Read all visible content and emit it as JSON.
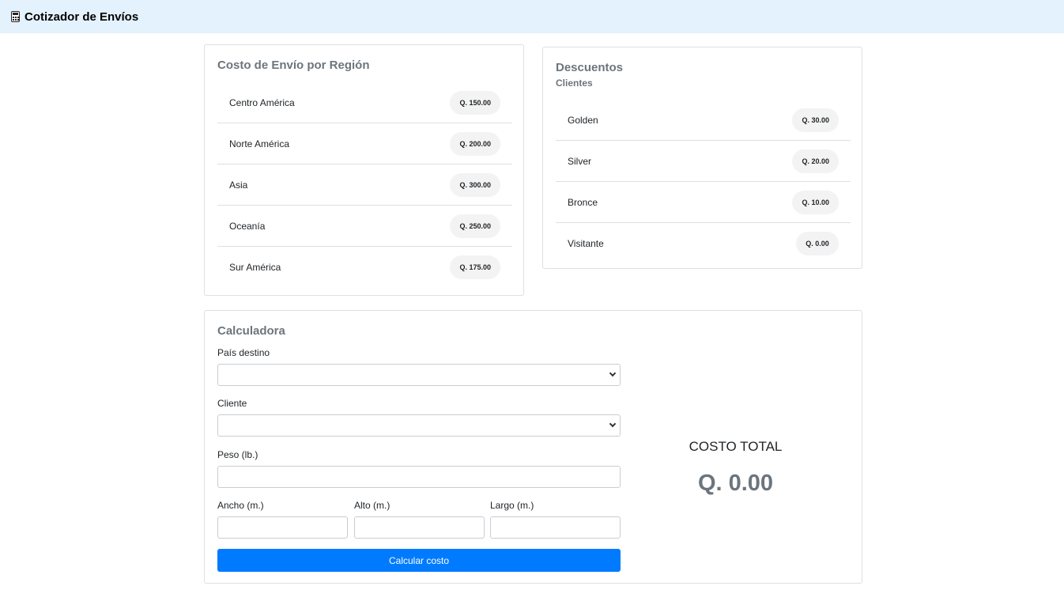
{
  "app": {
    "title": "Cotizador de Envíos",
    "icon": "calculator-icon"
  },
  "regions": {
    "title": "Costo de Envío por Región",
    "items": [
      {
        "label": "Centro América",
        "price": "Q. 150.00"
      },
      {
        "label": "Norte América",
        "price": "Q. 200.00"
      },
      {
        "label": "Asia",
        "price": "Q. 300.00"
      },
      {
        "label": "Oceanía",
        "price": "Q. 250.00"
      },
      {
        "label": "Sur América",
        "price": "Q. 175.00"
      }
    ]
  },
  "discounts": {
    "title": "Descuentos",
    "subtitle": "Clientes",
    "items": [
      {
        "label": "Golden",
        "price": "Q. 30.00"
      },
      {
        "label": "Silver",
        "price": "Q. 20.00"
      },
      {
        "label": "Bronce",
        "price": "Q. 10.00"
      },
      {
        "label": "Visitante",
        "price": "Q. 0.00"
      }
    ]
  },
  "calculator": {
    "title": "Calculadora",
    "country_label": "País destino",
    "country_value": "",
    "client_label": "Cliente",
    "client_value": "",
    "weight_label": "Peso (lb.)",
    "weight_value": "",
    "width_label": "Ancho (m.)",
    "width_value": "",
    "height_label": "Alto (m.)",
    "height_value": "",
    "length_label": "Largo (m.)",
    "length_value": "",
    "button_label": "Calcular costo",
    "total_label": "COSTO TOTAL",
    "total_value": "Q. 0.00"
  },
  "colors": {
    "navbar_bg": "#e3f2fd",
    "primary": "#007bff",
    "muted": "#6c757d"
  }
}
